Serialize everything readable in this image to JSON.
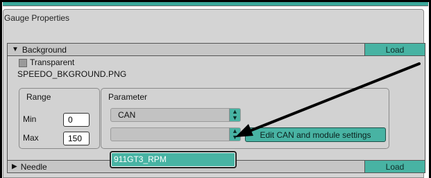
{
  "panel": {
    "title": "Gauge Properties"
  },
  "background_section": {
    "header": "Background",
    "load_label": "Load",
    "transparent_label": "Transparent",
    "filename": "SPEEDO_BKGROUND.PNG",
    "range": {
      "title": "Range",
      "min_label": "Min",
      "min_value": "0",
      "max_label": "Max",
      "max_value": "150"
    },
    "parameter": {
      "title": "Parameter",
      "source_value": "CAN",
      "channel_value": "",
      "edit_button": "Edit CAN and module settings"
    }
  },
  "dropdown": {
    "highlighted_option": "911GT3_RPM"
  },
  "needle_section": {
    "header": "Needle",
    "load_label": "Load"
  },
  "colors": {
    "accent": "#48b3a3",
    "panel": "#d4d4d4",
    "annotation_arrow": "#000000"
  },
  "icons": {
    "expanded": "triangle-down-icon",
    "collapsed": "triangle-right-icon",
    "select": "up-down-arrows-icon"
  }
}
